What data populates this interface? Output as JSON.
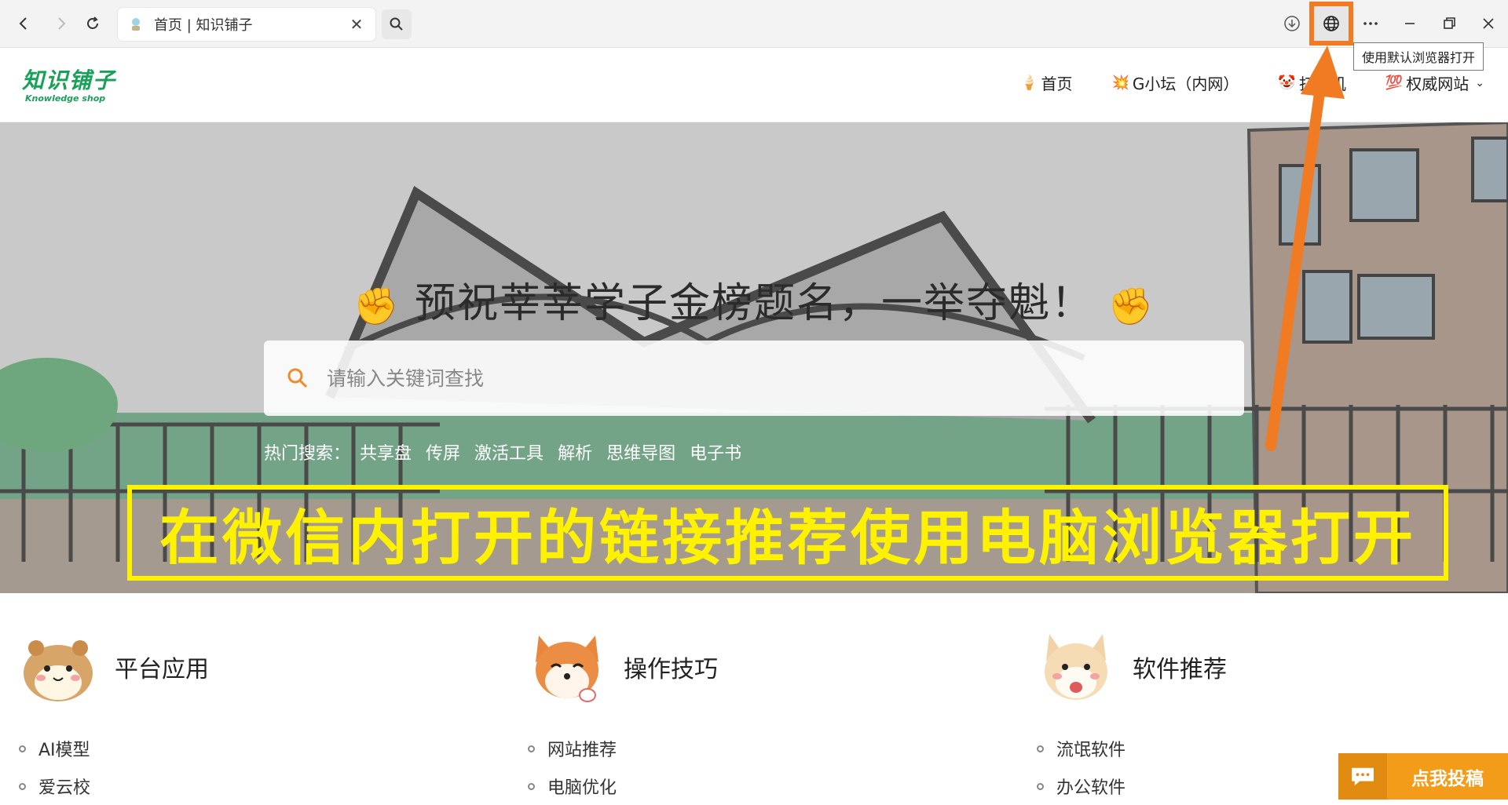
{
  "browser": {
    "tab_title": "首页 | 知识铺子",
    "tooltip": "使用默认浏览器打开",
    "icons": [
      "back-icon",
      "forward-icon",
      "reload-icon",
      "search-icon",
      "download-icon",
      "globe-icon",
      "more-icon",
      "minimize-icon",
      "restore-icon",
      "close-icon"
    ]
  },
  "site": {
    "logo_cn": "知识铺子",
    "logo_en": "Knowledge shop",
    "nav": [
      {
        "emoji": "🍦",
        "label": "首页"
      },
      {
        "emoji": "💥",
        "label": "G小坛（内网）"
      },
      {
        "emoji": "🤡",
        "label": "打印机"
      },
      {
        "emoji": "💯",
        "label": "权威网站"
      }
    ]
  },
  "hero": {
    "headline": "预祝莘莘学子金榜题名，一举夺魁！",
    "fist": "✊",
    "search_placeholder": "请输入关键词查找",
    "hot_label": "热门搜索：",
    "hot_items": [
      "共享盘",
      "传屏",
      "激活工具",
      "解析",
      "思维导图",
      "电子书"
    ],
    "banner": "在微信内打开的链接推荐使用电脑浏览器打开"
  },
  "categories": [
    {
      "title": "平台应用",
      "items": [
        "AI模型",
        "爱云校"
      ]
    },
    {
      "title": "操作技巧",
      "items": [
        "网站推荐",
        "电脑优化"
      ]
    },
    {
      "title": "软件推荐",
      "items": [
        "流氓软件",
        "办公软件"
      ]
    }
  ],
  "contribute_label": "点我投稿",
  "colors": {
    "accent_orange": "#f07b23",
    "banner_yellow": "#fff200",
    "brand_green": "#19a15a",
    "contribute": "#f39c1a"
  }
}
